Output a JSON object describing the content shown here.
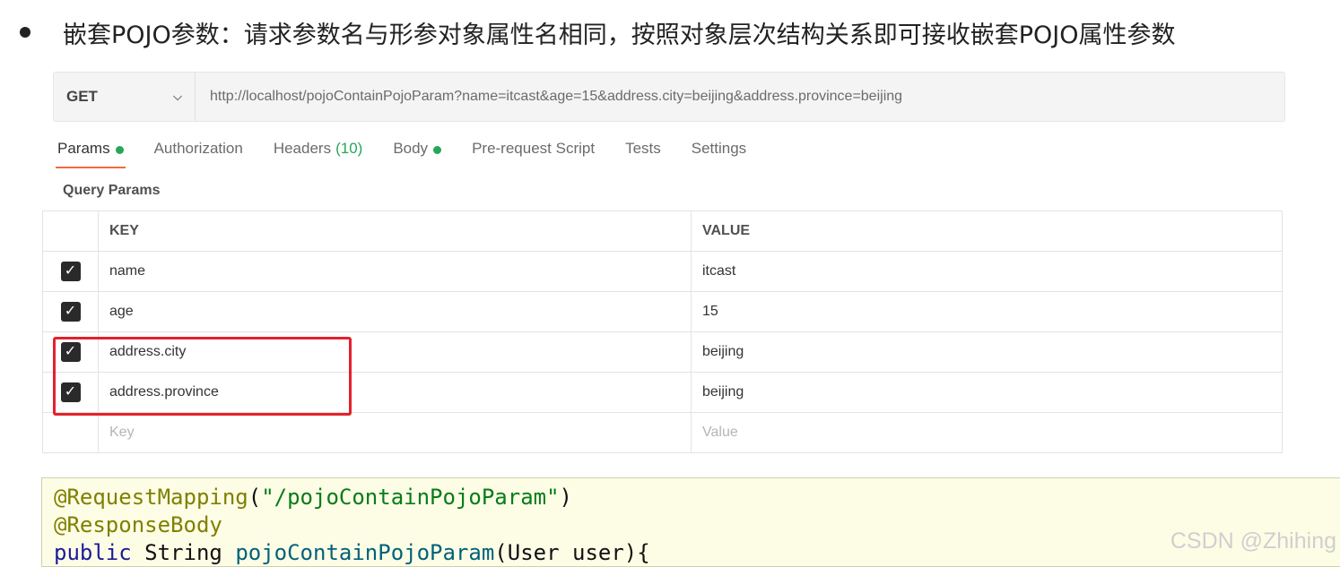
{
  "bullet": {
    "text": "嵌套POJO参数：请求参数名与形参对象属性名相同，按照对象层次结构关系即可接收嵌套POJO属性参数"
  },
  "request": {
    "method": "GET",
    "url": "http://localhost/pojoContainPojoParam?name=itcast&age=15&address.city=beijing&address.province=beijing"
  },
  "tabs": [
    {
      "label": "Params",
      "indicator": "green-dot",
      "active": true
    },
    {
      "label": "Authorization"
    },
    {
      "label": "Headers",
      "count": "(10)"
    },
    {
      "label": "Body",
      "indicator": "green-dot"
    },
    {
      "label": "Pre-request Script"
    },
    {
      "label": "Tests"
    },
    {
      "label": "Settings"
    }
  ],
  "query_params": {
    "title": "Query Params",
    "headers": {
      "key": "KEY",
      "value": "VALUE"
    },
    "rows": [
      {
        "checked": true,
        "key": "name",
        "value": "itcast"
      },
      {
        "checked": true,
        "key": "age",
        "value": "15"
      },
      {
        "checked": true,
        "key": "address.city",
        "value": "beijing"
      },
      {
        "checked": true,
        "key": "address.province",
        "value": "beijing"
      }
    ],
    "placeholder": {
      "key": "Key",
      "value": "Value"
    }
  },
  "code": {
    "line1": {
      "annotation": "@RequestMapping",
      "open": "(",
      "string": "\"/pojoContainPojoParam\"",
      "close": ")"
    },
    "line2": {
      "annotation": "@ResponseBody"
    },
    "line3": {
      "kw": "public",
      "type": "String",
      "method": "pojoContainPojoParam",
      "params": "(User user){"
    }
  },
  "watermark": "CSDN @Zhihing",
  "colors": {
    "accent": "#f26b3a",
    "indicator": "#26a65b",
    "highlight_box": "#e3212b",
    "code_bg": "#fdfde6"
  },
  "icons": {
    "check": "✓",
    "chevron": "⌵"
  }
}
